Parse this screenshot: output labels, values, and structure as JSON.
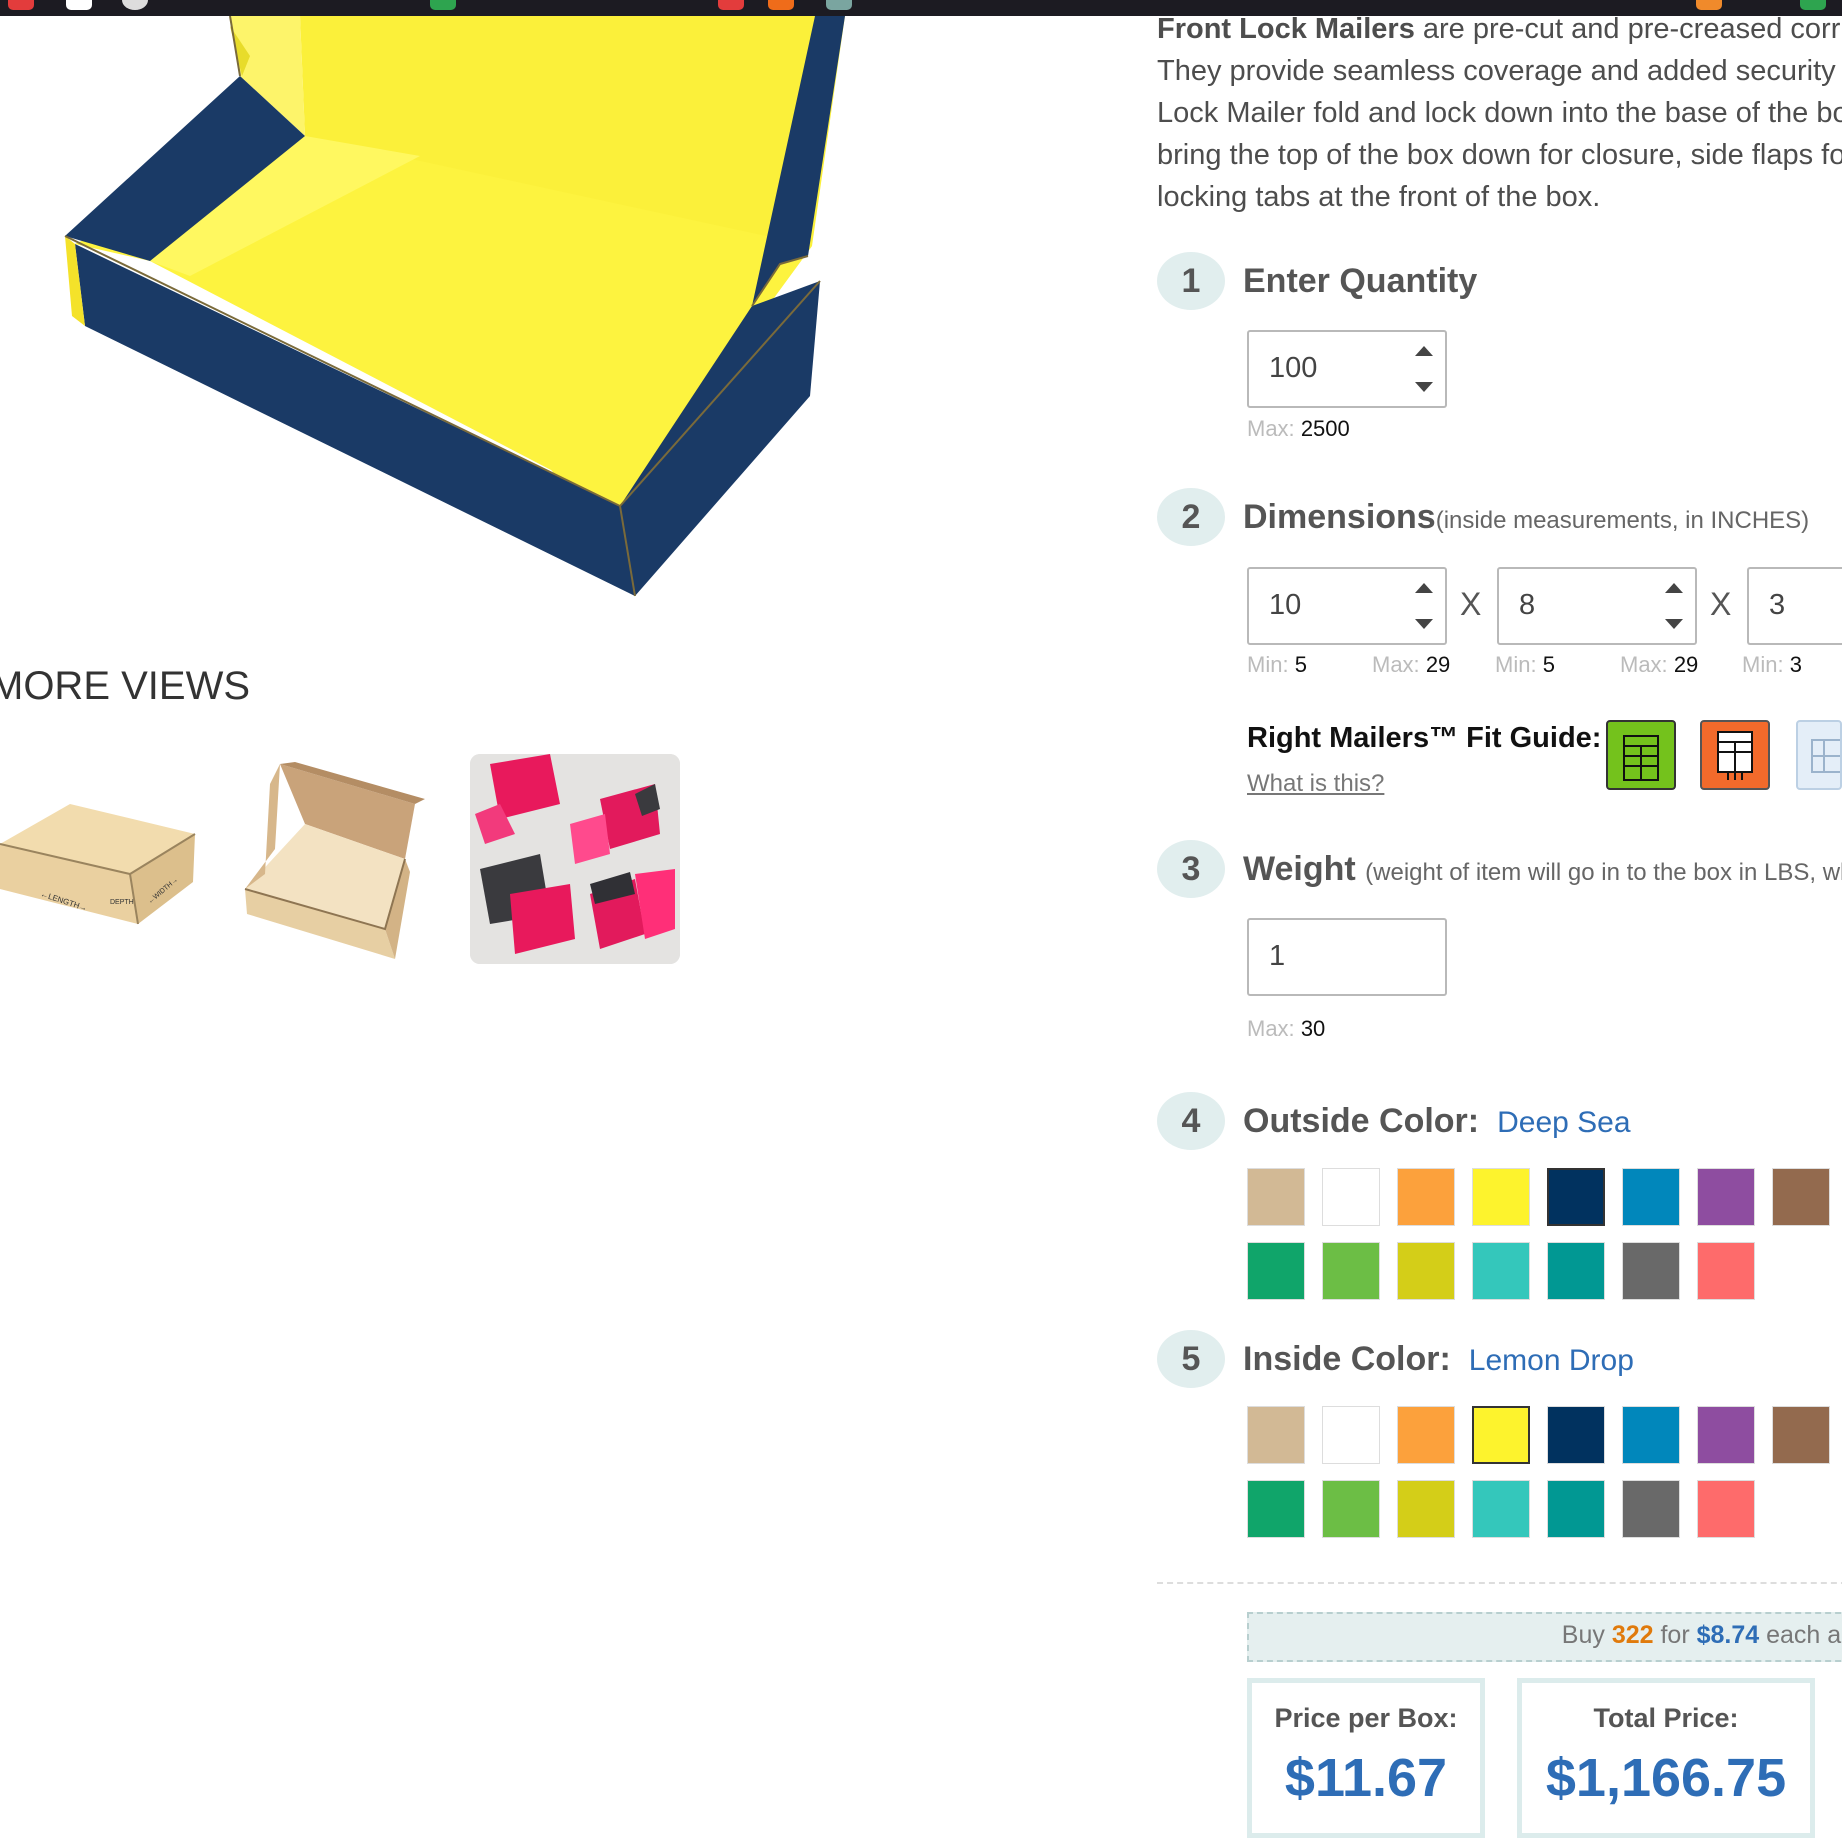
{
  "intro": {
    "lines": [
      {
        "bold": "Front Lock Mailers",
        "rest": " are pre-cut and pre-creased corrugat"
      },
      {
        "bold": "",
        "rest": "They provide seamless coverage and added security for y"
      },
      {
        "bold": "",
        "rest": "Lock Mailer fold and lock down into the base of the box to"
      },
      {
        "bold": "",
        "rest": "bring the top of the box down for closure, side flaps fold b"
      },
      {
        "bold": "",
        "rest": "locking tabs at the front of the box."
      }
    ]
  },
  "more_views": {
    "title": "MORE VIEWS"
  },
  "steps": {
    "quantity": {
      "number": "1",
      "title": "Enter Quantity",
      "value": "100",
      "max_label": "Max:",
      "max": "2500"
    },
    "dimensions": {
      "number": "2",
      "title": "Dimensions",
      "note": "(inside measurements, in INCHES)",
      "sep": "X",
      "fields": [
        {
          "value": "10",
          "min_label": "Min:",
          "min": "5",
          "max_label": "Max:",
          "max": "29"
        },
        {
          "value": "8",
          "min_label": "Min:",
          "min": "5",
          "max_label": "Max:",
          "max": "29"
        },
        {
          "value": "3",
          "min_label": "Min:",
          "min": "3"
        }
      ]
    },
    "fit_guide": {
      "label": "Right Mailers™ Fit Guide:",
      "link": "What is this?"
    },
    "weight": {
      "number": "3",
      "title": "Weight",
      "note": "(weight of item will go in to the box in LBS, whole",
      "value": "1",
      "max_label": "Max:",
      "max": "30"
    },
    "outside_color": {
      "number": "4",
      "title": "Outside Color:",
      "selected": "Deep Sea"
    },
    "inside_color": {
      "number": "5",
      "title": "Inside Color:",
      "selected": "Lemon Drop"
    }
  },
  "swatches": {
    "outside": [
      "#d2b995",
      "#ffffff",
      "#fca13c",
      "#fdf32d",
      "#01325f",
      "#0187bb",
      "#8e4da0",
      "#936a4e",
      "#10a56a",
      "#6cbe45",
      "#d4ce18",
      "#34c7bb",
      "#019893",
      "#696969",
      "#fe6b6b"
    ],
    "inside": [
      "#d2b995",
      "#ffffff",
      "#fca13c",
      "#fdf32d",
      "#01325f",
      "#0187bb",
      "#8e4da0",
      "#936a4e",
      "#10a56a",
      "#6cbe45",
      "#d4ce18",
      "#34c7bb",
      "#019893",
      "#696969",
      "#fe6b6b"
    ]
  },
  "buy": {
    "pre": "Buy ",
    "qty": "322",
    "mid": " for ",
    "price": "$8.74",
    "post": " each and"
  },
  "price": {
    "per_box_label": "Price per Box:",
    "per_box": "$11.67",
    "total_label": "Total Price:",
    "total": "$1,166.75"
  },
  "colors": {
    "accent": "#2e6db6",
    "step_bg": "#e1eeee",
    "box_outer": "#1a3a66",
    "box_inner": "#f6ee3a"
  }
}
